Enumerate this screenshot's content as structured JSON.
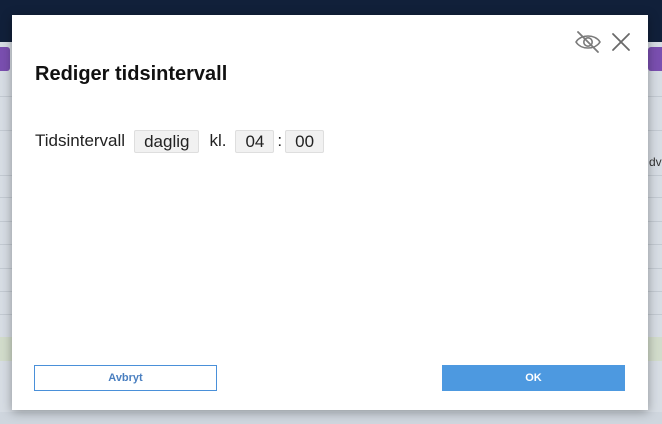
{
  "background": {
    "right_edge_text": "dv"
  },
  "dialog": {
    "title": "Rediger tidsintervall",
    "icons": {
      "hide": "eye-slash-icon",
      "close": "close-icon"
    },
    "interval": {
      "label": "Tidsintervall",
      "frequency": "daglig",
      "at_label": "kl.",
      "hour": "04",
      "separator": ":",
      "minute": "00"
    },
    "buttons": {
      "cancel": "Avbryt",
      "ok": "OK"
    }
  },
  "colors": {
    "primary": "#4d99e0",
    "topbar": "#11203a",
    "accent_purple": "#7a4fb0"
  }
}
